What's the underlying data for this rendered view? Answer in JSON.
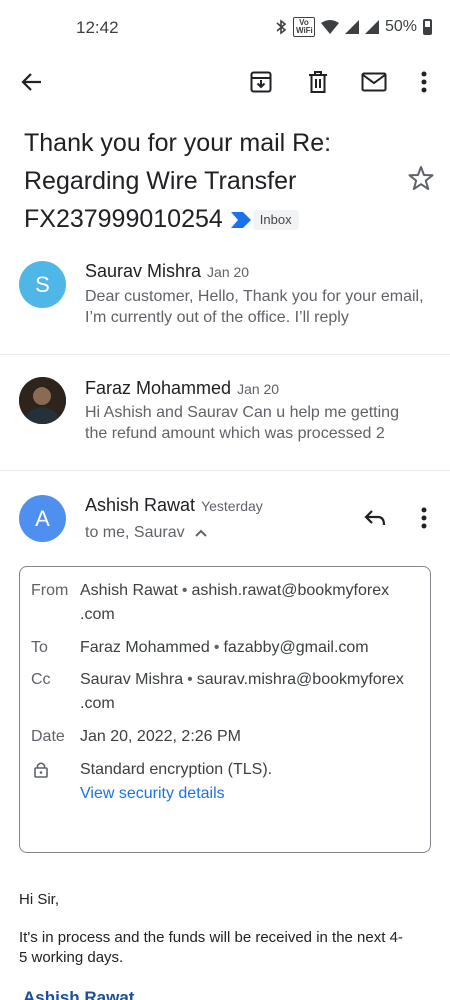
{
  "status": {
    "time": "12:42",
    "volte_top": "Vo",
    "volte_bottom": "WiFi",
    "battery": "50%"
  },
  "toolbar": {
    "back": "arrow-back-icon",
    "archive": "archive-icon",
    "delete": "delete-icon",
    "mark_unread": "mail-icon",
    "more": "more-vert-icon"
  },
  "subject": {
    "line1": "Thank you for your mail Re:",
    "line2": "Regarding Wire Transfer",
    "line3": "FX237999010254",
    "label": "Inbox"
  },
  "threads": [
    {
      "initial": "S",
      "avatar_color": "#4fb6e8",
      "name": "Saurav Mishra",
      "date": "Jan 20",
      "snippet": "Dear customer, Hello, Thank you for your email, I’m currently out of the office. I’ll reply"
    },
    {
      "initial": "",
      "avatar_color": "#3a2a22",
      "name": "Faraz Mohammed",
      "date": "Jan 20",
      "snippet": "Hi Ashish and Saurav Can u help me getting the refund amount which was processed 2"
    }
  ],
  "open_message": {
    "initial": "A",
    "avatar_color": "#4f8ff0",
    "name": "Ashish Rawat",
    "date": "Yesterday",
    "to_line": "to me, Saurav"
  },
  "details": {
    "from_label": "From",
    "from_name": "Ashish Rawat",
    "from_email": "ashish.rawat@bookmyforex",
    "from_email_cont": ".com",
    "to_label": "To",
    "to_name": "Faraz Mohammed",
    "to_email": "fazabby@gmail.com",
    "cc_label": "Cc",
    "cc_name": "Saurav Mishra",
    "cc_email": "saurav.mishra@bookmyforex",
    "cc_email_cont": ".com",
    "date_label": "Date",
    "date_value": "Jan 20, 2022, 2:26 PM",
    "security_value": "Standard encryption (TLS).",
    "security_link": "View security details"
  },
  "body": {
    "greeting": "Hi Sir,",
    "line1": "It's in process and the funds will be received in the next 4-",
    "line2": "5 working days.",
    "signature": "Ashish Rawat"
  },
  "colors": {
    "accent": "#1a73e8",
    "important_marker": "#1a73e8"
  }
}
